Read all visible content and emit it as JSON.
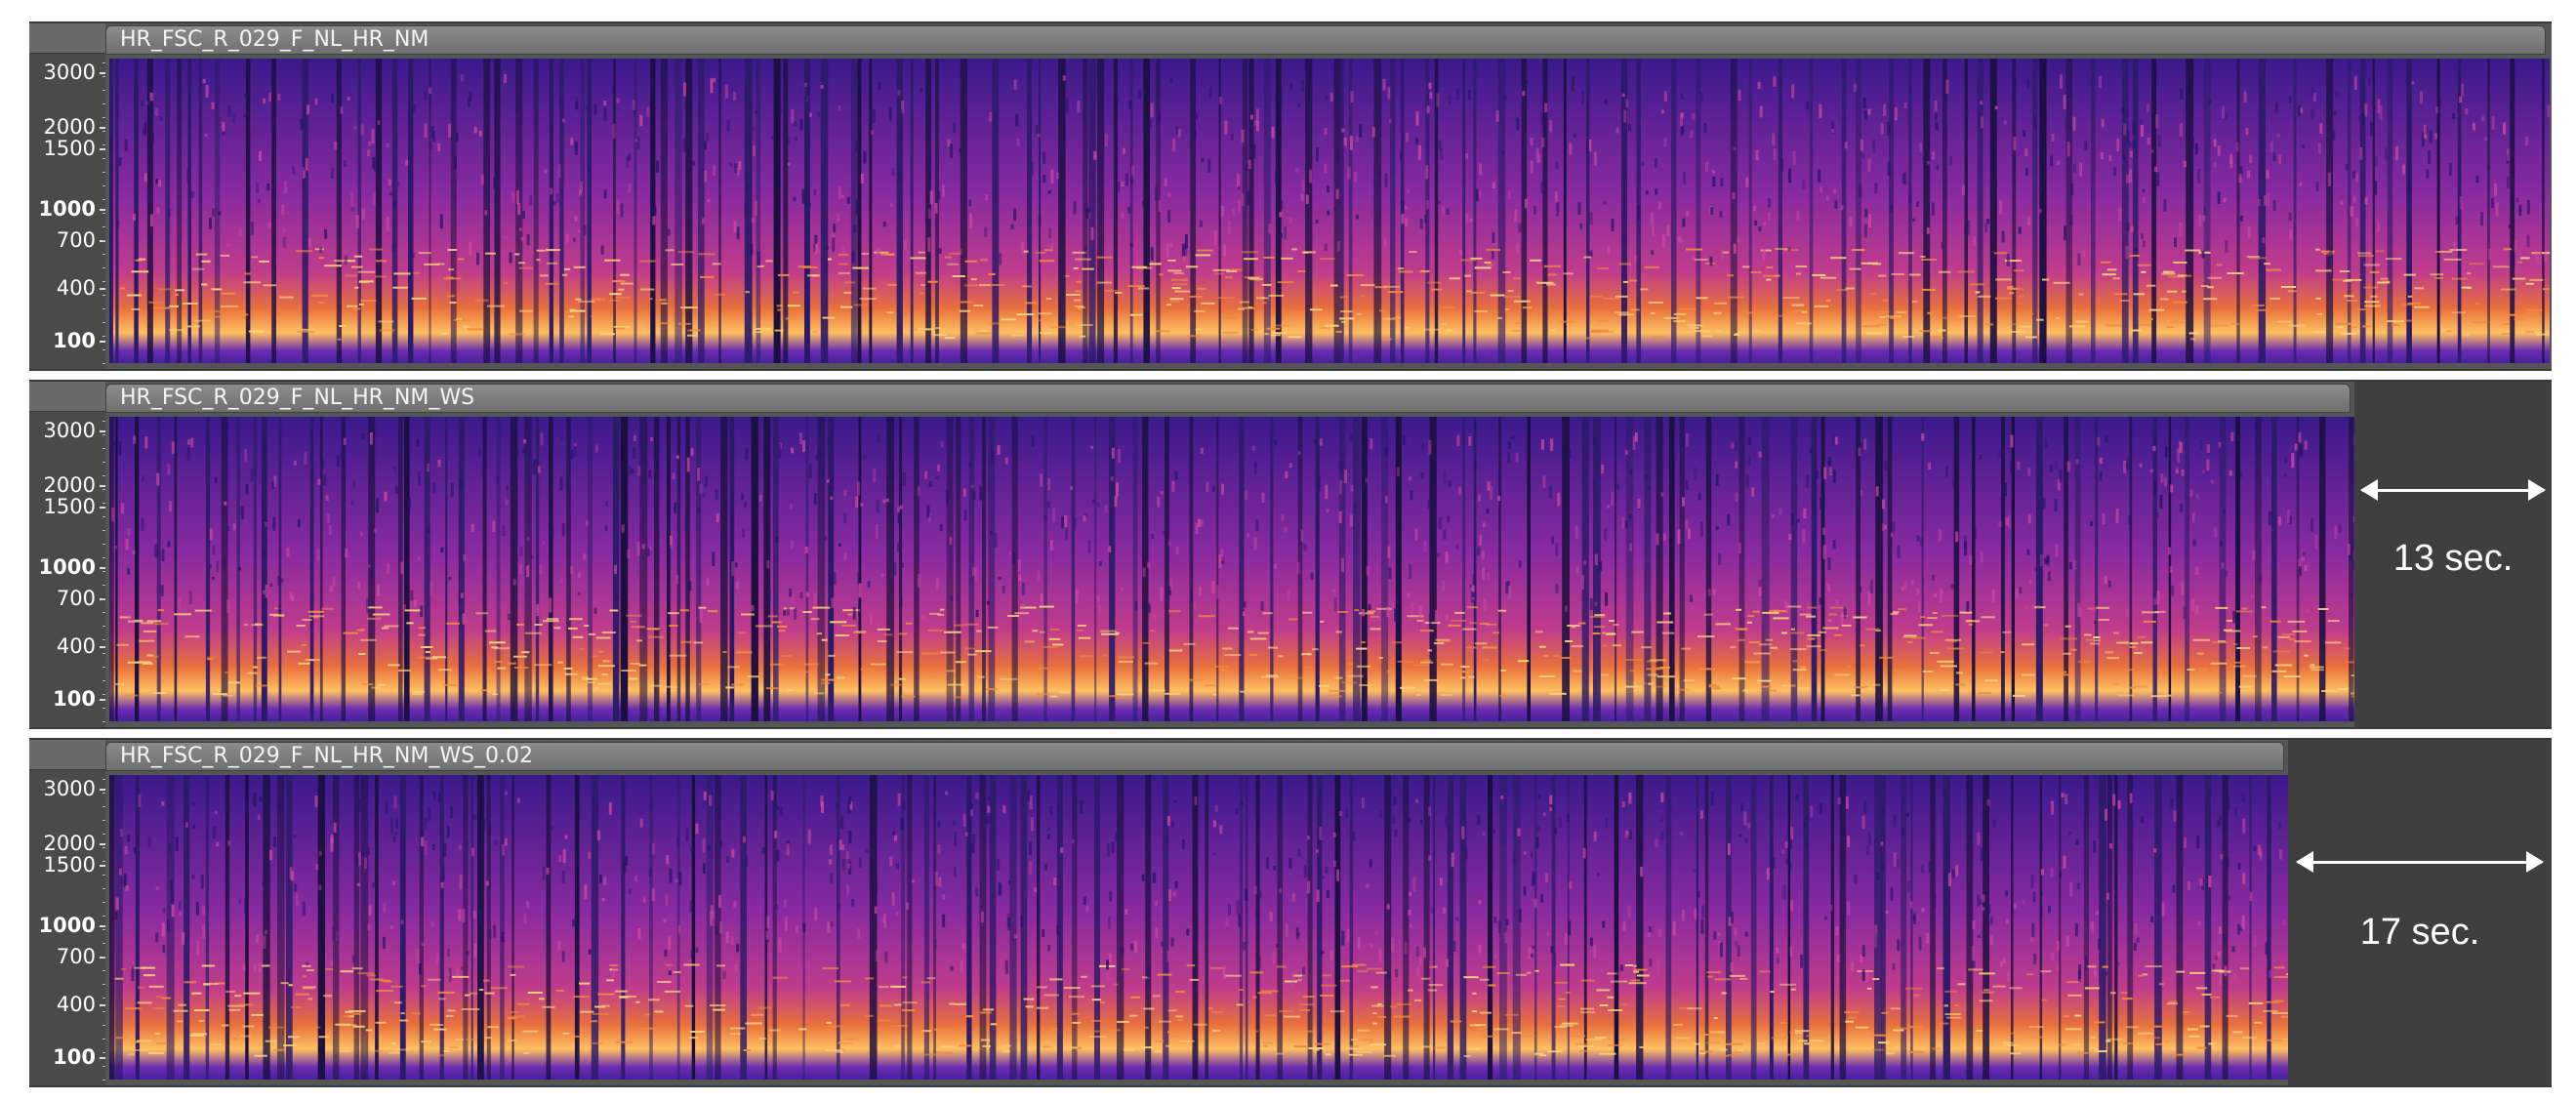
{
  "tracks": [
    {
      "name": "HR_FSC_R_029_F_NL_HR_NM",
      "duration": ""
    },
    {
      "name": "HR_FSC_R_029_F_NL_HR_NM_WS",
      "duration": "13 sec."
    },
    {
      "name": "HR_FSC_R_029_F_NL_HR_NM_WS_0.02",
      "duration": "17 sec."
    }
  ],
  "axis": {
    "ticks": [
      "3000",
      "2000",
      "1500",
      "1000",
      "700",
      "400",
      "100"
    ]
  },
  "colors": {
    "background": "#555555",
    "spectrogram_low": "#2a1a7a",
    "spectrogram_mid": "#b0309a",
    "spectrogram_high": "#ffb040"
  }
}
